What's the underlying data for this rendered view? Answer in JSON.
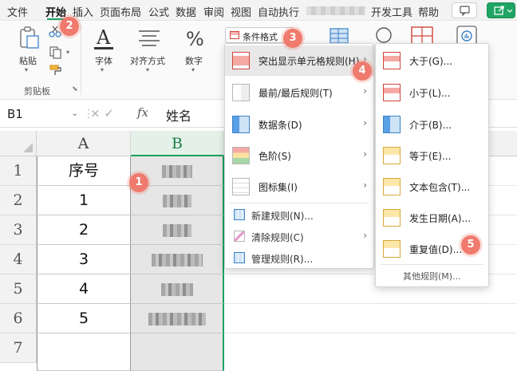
{
  "tabs": [
    "文件",
    "开始",
    "插入",
    "页面布局",
    "公式",
    "数据",
    "审阅",
    "视图",
    "自动执行",
    "开发工具",
    "帮助"
  ],
  "ribbon": {
    "paste": "粘贴",
    "clipboard_group": "剪贴板",
    "font": "字体",
    "alignment": "对齐方式",
    "number": "数字",
    "conditional_format": "条件格式"
  },
  "formula_bar": {
    "name_box": "B1",
    "ops": "× ✓",
    "fx": "fx",
    "content": "姓名"
  },
  "sheet": {
    "columns": [
      "A",
      "B"
    ],
    "rows": [
      "1",
      "2",
      "3",
      "4",
      "5",
      "6",
      "7"
    ],
    "col_a": [
      "序号",
      "1",
      "2",
      "3",
      "4",
      "5",
      ""
    ]
  },
  "menu": {
    "items": [
      "突出显示单元格规则(H)",
      "最前/最后规则(T)",
      "数据条(D)",
      "色阶(S)",
      "图标集(I)",
      "新建规则(N)...",
      "清除规则(C)",
      "管理规则(R)..."
    ]
  },
  "submenu": {
    "items": [
      "大于(G)...",
      "小于(L)...",
      "介于(B)...",
      "等于(E)...",
      "文本包含(T)...",
      "发生日期(A)...",
      "重复值(D)..."
    ],
    "more": "其他规则(M)..."
  },
  "badges": [
    "1",
    "2",
    "3",
    "4",
    "5"
  ],
  "accent_green": "#1aa260",
  "badge_color": "#ef7a6d"
}
